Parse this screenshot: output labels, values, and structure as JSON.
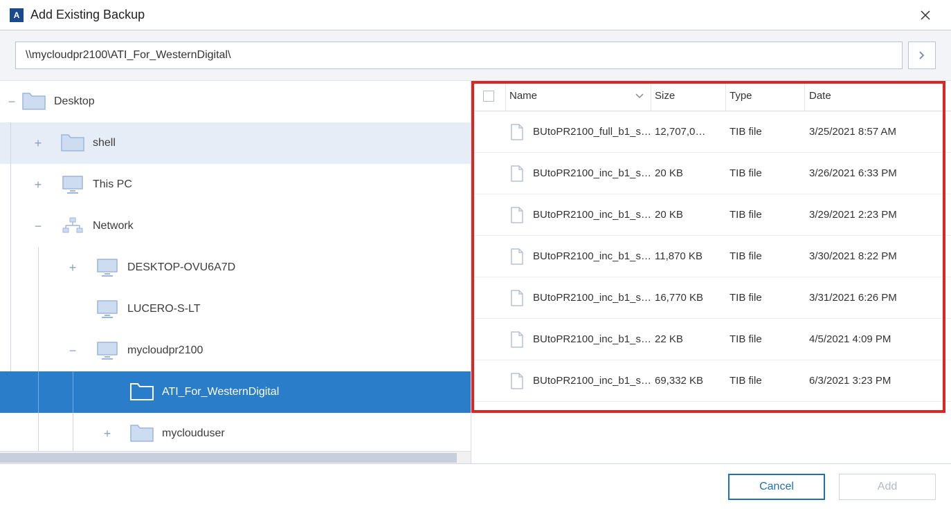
{
  "window": {
    "title": "Add Existing Backup",
    "icon_letter": "A"
  },
  "path": {
    "value": "\\\\mycloudpr2100\\ATI_For_WesternDigital\\"
  },
  "tree": {
    "desktop": "Desktop",
    "shell": "shell",
    "thispc": "This PC",
    "network": "Network",
    "node_desktop": "DESKTOP-OVU6A7D",
    "node_lucero": "LUCERO-S-LT",
    "node_mycloud": "mycloudpr2100",
    "folder_ati": "ATI_For_WesternDigital",
    "folder_user": "myclouduser"
  },
  "columns": {
    "name": "Name",
    "size": "Size",
    "type": "Type",
    "date": "Date"
  },
  "files": [
    {
      "name": "BUtoPR2100_full_b1_s…",
      "size": "12,707,0…",
      "type": "TIB file",
      "date": "3/25/2021 8:57 AM"
    },
    {
      "name": "BUtoPR2100_inc_b1_s…",
      "size": "20 KB",
      "type": "TIB file",
      "date": "3/26/2021 6:33 PM"
    },
    {
      "name": "BUtoPR2100_inc_b1_s…",
      "size": "20 KB",
      "type": "TIB file",
      "date": "3/29/2021 2:23 PM"
    },
    {
      "name": "BUtoPR2100_inc_b1_s…",
      "size": "11,870 KB",
      "type": "TIB file",
      "date": "3/30/2021 8:22 PM"
    },
    {
      "name": "BUtoPR2100_inc_b1_s…",
      "size": "16,770 KB",
      "type": "TIB file",
      "date": "3/31/2021 6:26 PM"
    },
    {
      "name": "BUtoPR2100_inc_b1_s…",
      "size": "22 KB",
      "type": "TIB file",
      "date": "4/5/2021 4:09 PM"
    },
    {
      "name": "BUtoPR2100_inc_b1_s…",
      "size": "69,332 KB",
      "type": "TIB file",
      "date": "6/3/2021 3:23 PM"
    }
  ],
  "buttons": {
    "cancel": "Cancel",
    "add": "Add"
  }
}
